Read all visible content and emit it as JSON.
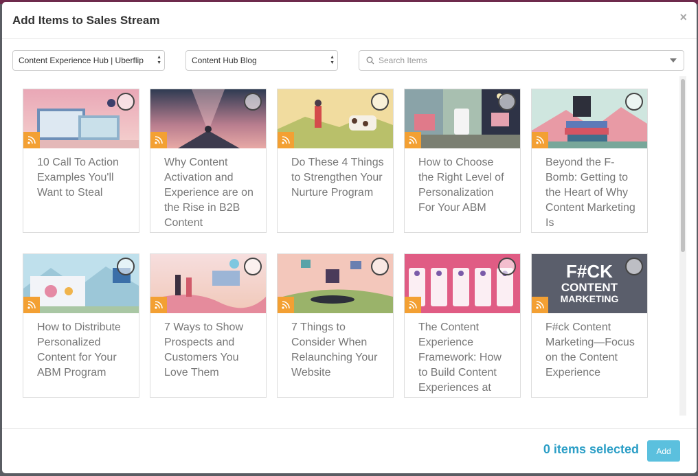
{
  "modal": {
    "title": "Add Items to Sales Stream",
    "close_label": "×"
  },
  "filters": {
    "hub_select": "Content Experience Hub | Uberflip",
    "stream_select": "Content Hub Blog",
    "search_placeholder": "Search Items"
  },
  "items": [
    {
      "title": "10 Call To Action Examples You'll Want to Steal"
    },
    {
      "title": "Why Content Activation and Experience are on the Rise in B2B Content"
    },
    {
      "title": "Do These 4 Things to Strengthen Your Nurture Program"
    },
    {
      "title": "How to Choose the Right Level of Personalization For Your ABM"
    },
    {
      "title": "Beyond the F-Bomb: Getting to the Heart of Why Content Marketing Is"
    },
    {
      "title": "How to Distribute Personalized Content for Your ABM Program"
    },
    {
      "title": "7 Ways to Show Prospects and Customers You Love Them"
    },
    {
      "title": "7 Things to Consider When Relaunching Your Website"
    },
    {
      "title": "The Content Experience Framework: How to Build Content Experiences at"
    },
    {
      "title": "F#ck Content Marketing—Focus on the Content Experience"
    }
  ],
  "thumb_texts": {
    "fck_line1": "F#CK",
    "fck_line2": "CONTENT",
    "fck_line3": "MARKETING"
  },
  "footer": {
    "selected_count": "0 items selected",
    "add_label": "Add"
  },
  "colors": {
    "accent": "#2b9ec6",
    "add_button": "#5bc0de",
    "badge": "#f3a033"
  }
}
